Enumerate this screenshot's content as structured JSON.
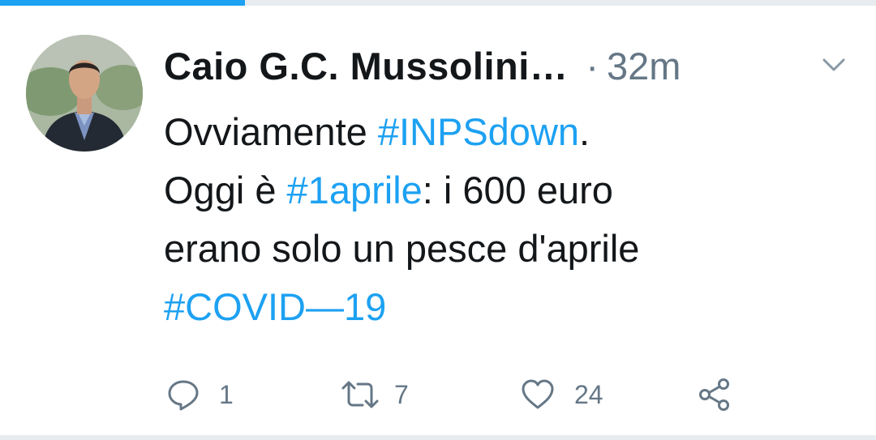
{
  "progress": {
    "fraction": 0.28,
    "color": "#1da1f2"
  },
  "tweet": {
    "author": {
      "display_name": "Caio G.C. Mussolini…"
    },
    "separator": "·",
    "timestamp": "32m",
    "text": {
      "line1": {
        "pre": "Ovviamente ",
        "hashtag": "#INPSdown",
        "post": "."
      },
      "line2": {
        "pre": "Oggi è ",
        "hashtag": "#1aprile",
        "post": ": i 600 euro"
      },
      "line3": {
        "text": "erano solo un pesce d'aprile"
      },
      "line4": {
        "hashtag": "#COVID—19"
      }
    },
    "actions": {
      "reply": {
        "icon": "reply-icon",
        "count": "1"
      },
      "retweet": {
        "icon": "retweet-icon",
        "count": "7"
      },
      "like": {
        "icon": "heart-icon",
        "count": "24"
      },
      "share": {
        "icon": "share-icon"
      }
    }
  },
  "colors": {
    "text": "#14171a",
    "secondary": "#657786",
    "link": "#1da1f2"
  }
}
